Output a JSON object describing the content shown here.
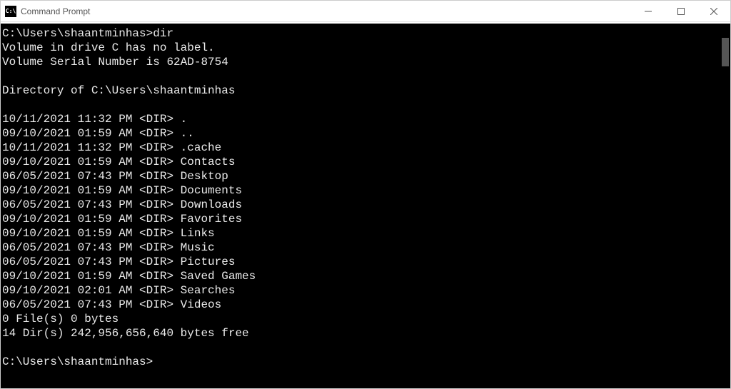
{
  "titlebar": {
    "icon_label": "C:\\",
    "title": "Command Prompt"
  },
  "terminal": {
    "prompt1": "C:\\Users\\shaantminhas>",
    "command1": "dir",
    "vol_line": " Volume in drive C has no label.",
    "serial_line": " Volume Serial Number is 62AD-8754",
    "dir_of_line": " Directory of C:\\Users\\shaantminhas",
    "entries": [
      {
        "date": "10/11/2021",
        "time": "11:32 PM",
        "type": "<DIR>",
        "name": "."
      },
      {
        "date": "09/10/2021",
        "time": "01:59 AM",
        "type": "<DIR>",
        "name": ".."
      },
      {
        "date": "10/11/2021",
        "time": "11:32 PM",
        "type": "<DIR>",
        "name": ".cache"
      },
      {
        "date": "09/10/2021",
        "time": "01:59 AM",
        "type": "<DIR>",
        "name": "Contacts"
      },
      {
        "date": "06/05/2021",
        "time": "07:43 PM",
        "type": "<DIR>",
        "name": "Desktop"
      },
      {
        "date": "09/10/2021",
        "time": "01:59 AM",
        "type": "<DIR>",
        "name": "Documents"
      },
      {
        "date": "06/05/2021",
        "time": "07:43 PM",
        "type": "<DIR>",
        "name": "Downloads"
      },
      {
        "date": "09/10/2021",
        "time": "01:59 AM",
        "type": "<DIR>",
        "name": "Favorites"
      },
      {
        "date": "09/10/2021",
        "time": "01:59 AM",
        "type": "<DIR>",
        "name": "Links"
      },
      {
        "date": "06/05/2021",
        "time": "07:43 PM",
        "type": "<DIR>",
        "name": "Music"
      },
      {
        "date": "06/05/2021",
        "time": "07:43 PM",
        "type": "<DIR>",
        "name": "Pictures"
      },
      {
        "date": "09/10/2021",
        "time": "01:59 AM",
        "type": "<DIR>",
        "name": "Saved Games"
      },
      {
        "date": "09/10/2021",
        "time": "02:01 AM",
        "type": "<DIR>",
        "name": "Searches"
      },
      {
        "date": "06/05/2021",
        "time": "07:43 PM",
        "type": "<DIR>",
        "name": "Videos"
      }
    ],
    "summary1": "               0 File(s)              0 bytes",
    "summary2": "              14 Dir(s)  242,956,656,640 bytes free",
    "prompt2": "C:\\Users\\shaantminhas>"
  }
}
